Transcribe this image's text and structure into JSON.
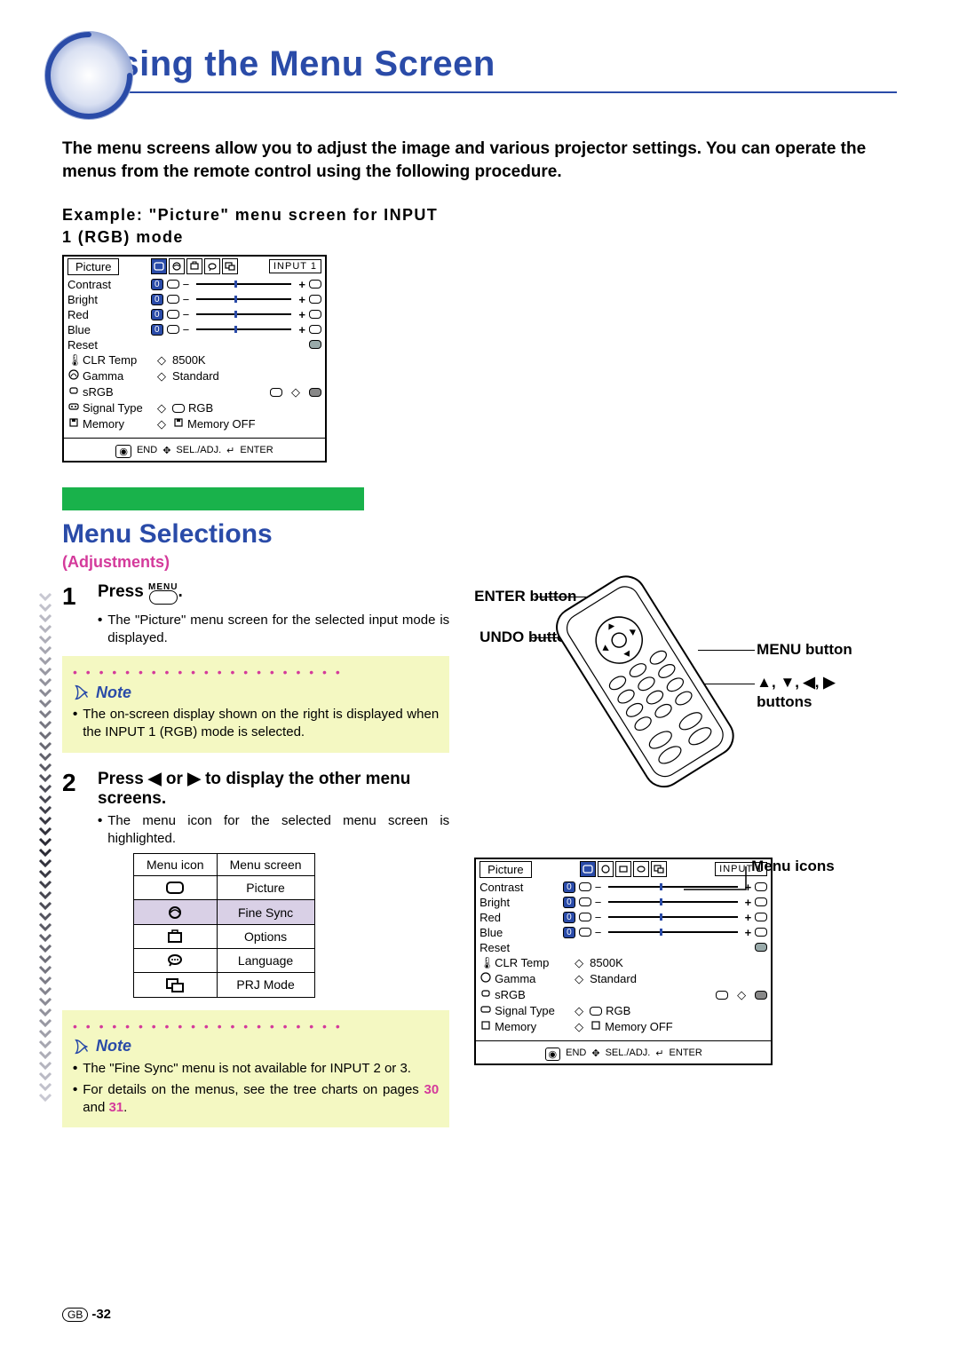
{
  "header": {
    "title": "Using the Menu Screen"
  },
  "intro": "The menu screens allow you to adjust the image and various projector settings. You can operate the menus from the remote control using the following procedure.",
  "example_caption": "Example: \"Picture\" menu screen for INPUT 1 (RGB) mode",
  "osd": {
    "tab": "Picture",
    "input": "INPUT 1",
    "rows_adjust": [
      {
        "label": "Contrast"
      },
      {
        "label": "Bright"
      },
      {
        "label": "Red"
      },
      {
        "label": "Blue"
      }
    ],
    "reset": "Reset",
    "settings": [
      {
        "label": "CLR Temp",
        "value": "8500K"
      },
      {
        "label": "Gamma",
        "value": "Standard"
      },
      {
        "label": "sRGB",
        "value": ""
      },
      {
        "label": "Signal Type",
        "value": "RGB"
      },
      {
        "label": "Memory",
        "value": "Memory OFF"
      }
    ],
    "footer": {
      "end": "END",
      "sel": "SEL./ADJ.",
      "enter": "ENTER"
    }
  },
  "section": {
    "heading": "Menu Selections",
    "sub": "(Adjustments)"
  },
  "steps": {
    "s1": {
      "num": "1",
      "lead_prefix": "Press ",
      "menu_word": "MENU",
      "lead_suffix": ".",
      "bullet": "The \"Picture\" menu screen for the selected input mode is displayed."
    },
    "note1": {
      "label": "Note",
      "bullet": "The on-screen display shown on the right is displayed when the INPUT 1 (RGB) mode is selected."
    },
    "s2": {
      "num": "2",
      "lead": "Press ◀ or ▶ to display the other menu screens.",
      "bullet": "The menu icon for the selected menu screen is highlighted."
    },
    "icon_table": {
      "h1": "Menu icon",
      "h2": "Menu screen",
      "rows": [
        {
          "name": "Picture"
        },
        {
          "name": "Fine Sync",
          "hl": true
        },
        {
          "name": "Options"
        },
        {
          "name": "Language"
        },
        {
          "name": "PRJ Mode"
        }
      ]
    },
    "note2": {
      "label": "Note",
      "b1": "The \"Fine Sync\" menu is not available for INPUT 2 or 3.",
      "b2_a": "For details on the menus, see the tree charts on pages ",
      "b2_p1": "30",
      "b2_mid": " and ",
      "b2_p2": "31",
      "b2_end": "."
    }
  },
  "remote": {
    "enter": "ENTER button",
    "undo": "UNDO button",
    "menu": "MENU button",
    "arrows": "▲, ▼, ◀, ▶ buttons",
    "menu_icons": "Menu icons"
  },
  "footer": {
    "region": "GB",
    "page": "-32"
  }
}
